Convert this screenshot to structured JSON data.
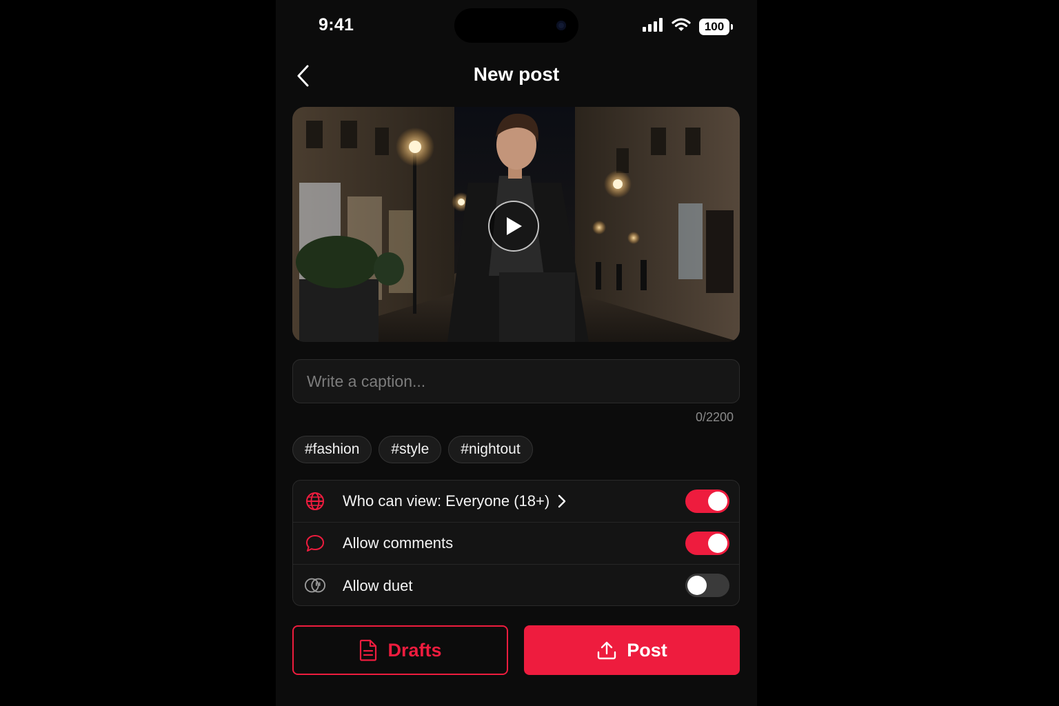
{
  "status_bar": {
    "time": "9:41",
    "battery": "100",
    "icons": [
      "signal-icon",
      "wifi-icon",
      "battery-icon"
    ]
  },
  "header": {
    "title": "New post",
    "back_icon": "chevron-left-icon"
  },
  "media": {
    "play_icon": "play-icon"
  },
  "caption": {
    "placeholder": "Write a caption...",
    "value": "",
    "counter": "0/2200"
  },
  "hashtags": [
    "#fashion",
    "#style",
    "#nightout"
  ],
  "settings": [
    {
      "icon": "globe-icon",
      "label": "Who can view: Everyone (18+)",
      "has_chevron": true,
      "enabled": true
    },
    {
      "icon": "comment-icon",
      "label": "Allow comments",
      "has_chevron": false,
      "enabled": true
    },
    {
      "icon": "duet-icon",
      "label": "Allow duet",
      "has_chevron": false,
      "enabled": false
    }
  ],
  "actions": {
    "drafts_label": "Drafts",
    "post_label": "Post",
    "drafts_icon": "document-icon",
    "post_icon": "upload-icon"
  },
  "colors": {
    "accent": "#ee1c3e",
    "background": "#0c0c0c",
    "surface": "#141414"
  }
}
